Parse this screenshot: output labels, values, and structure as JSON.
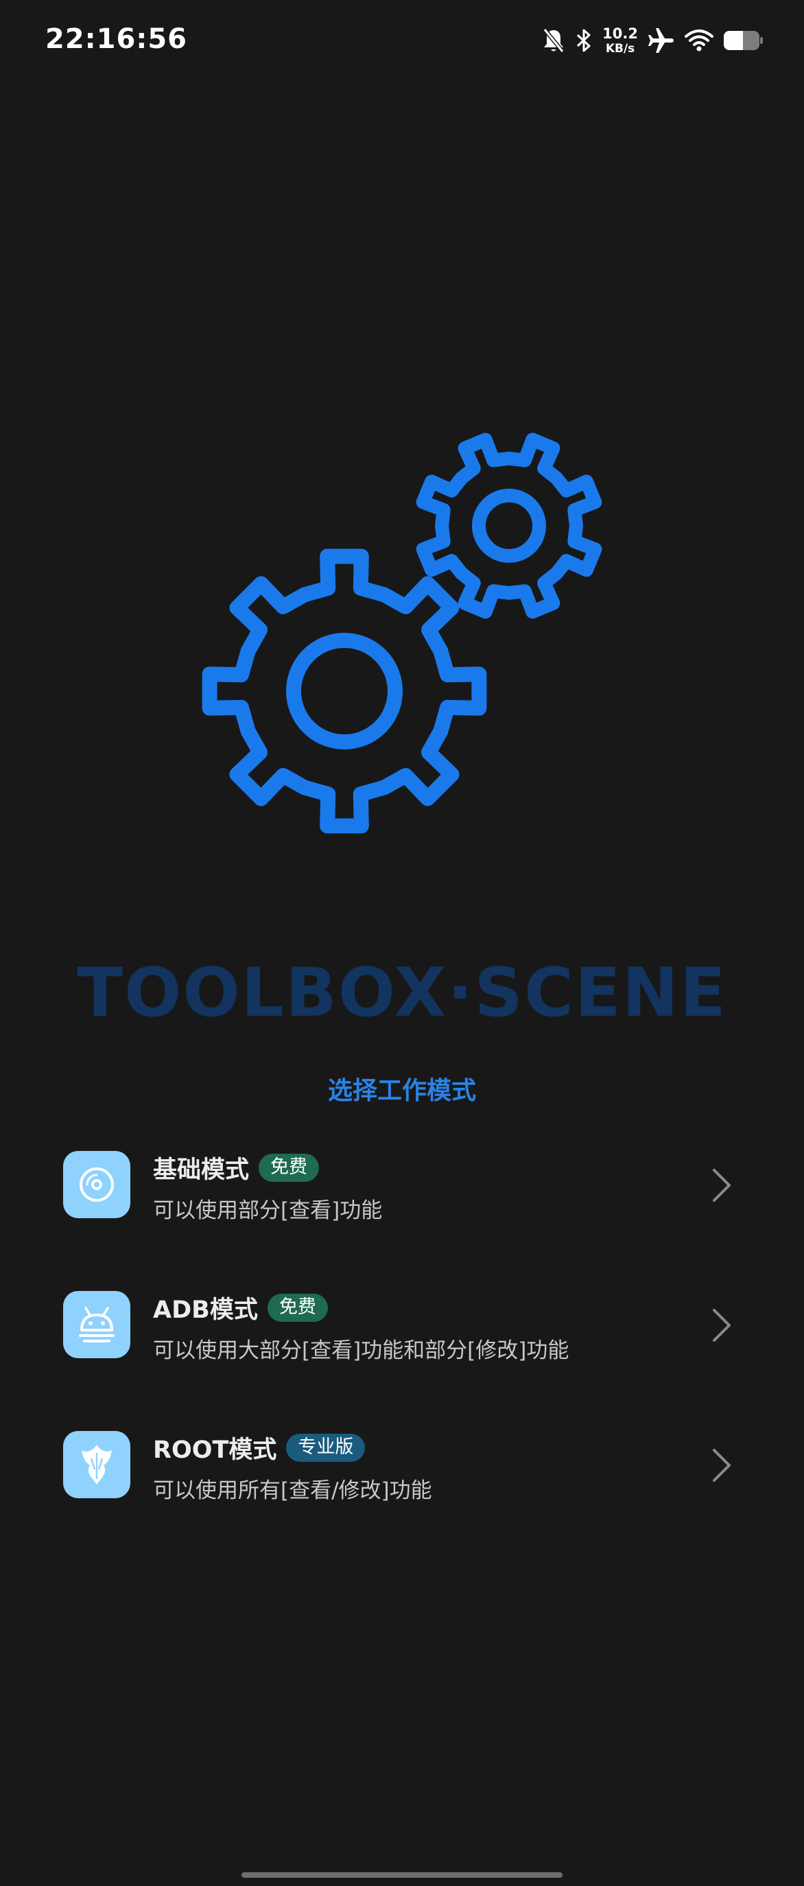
{
  "status_bar": {
    "time": "22:16:56",
    "net_speed_value": "10.2",
    "net_speed_unit": "KB/s",
    "icons": [
      "bell-off-icon",
      "bluetooth-icon",
      "airplane-icon",
      "wifi-icon",
      "battery-icon"
    ]
  },
  "hero": {
    "icon": "gears-icon",
    "accent_color": "#1a7aec"
  },
  "brand": {
    "title": "TOOLBOX·SCENE"
  },
  "subtitle": "选择工作模式",
  "modes": [
    {
      "title": "基础模式",
      "badge": "免费",
      "description": "可以使用部分[查看]功能",
      "icon": "disc-icon"
    },
    {
      "title": "ADB模式",
      "badge": "免费",
      "description": "可以使用大部分[查看]功能和部分[修改]功能",
      "icon": "android-icon"
    },
    {
      "title": "ROOT模式",
      "badge": "专业版",
      "description": "可以使用所有[查看/修改]功能",
      "icon": "magisk-icon"
    }
  ],
  "colors": {
    "background": "#181818",
    "accent": "#2b82e4",
    "icon_tile": "#8fd2fd",
    "badge_free": "#1f6a52",
    "badge_pro": "#1b5b7c"
  }
}
